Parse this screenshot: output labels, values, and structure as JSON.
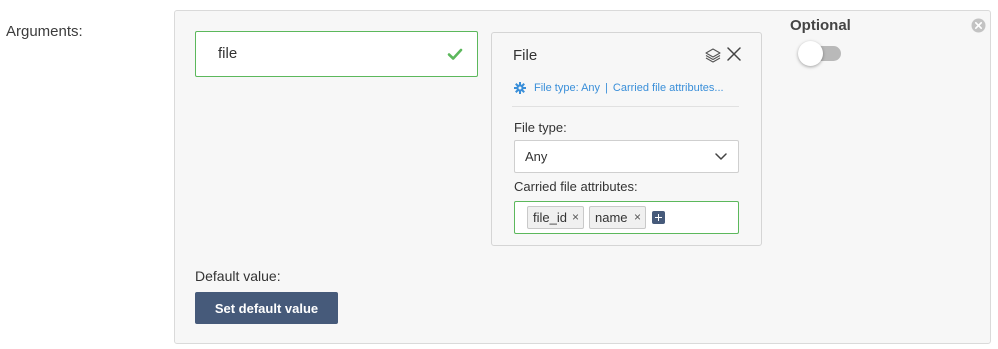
{
  "arguments_label": "Arguments:",
  "argument": {
    "name_value": "file",
    "name_status_icon": "check-icon",
    "type_card": {
      "title": "File",
      "summary": {
        "icon": "gear-icon",
        "file_type": "File type: Any",
        "separator": "|",
        "attributes": "Carried file attributes..."
      },
      "file_type_label": "File type:",
      "file_type_value": "Any",
      "carried_attributes_label": "Carried file attributes:",
      "carried_attributes": [
        "file_id",
        "name"
      ],
      "tag_remove_glyph": "×"
    },
    "optional_label": "Optional",
    "optional_enabled": false,
    "default_value_label": "Default value:",
    "set_default_button": "Set default value"
  },
  "colors": {
    "valid_border": "#5cb85c",
    "accent_link": "#3a8fd9",
    "primary_button": "#465a7a",
    "panel_bg": "#f7f7f7"
  }
}
